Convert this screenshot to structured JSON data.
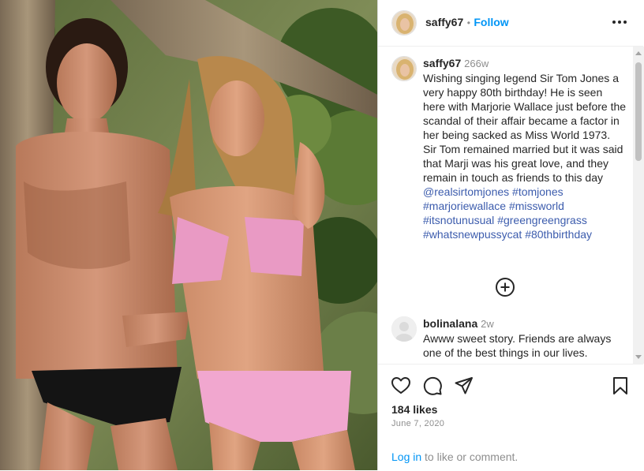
{
  "post": {
    "username": "saffy67",
    "separator": "•",
    "follow_label": "Follow",
    "more_icon": "more-horizontal-icon"
  },
  "caption": {
    "username": "saffy67",
    "time": "266w",
    "text": "Wishing singing legend Sir Tom Jones a very happy 80th birthday! He is seen here with Marjorie Wallace just before the scandal of their affair became a factor in her being sacked as Miss World 1973.  Sir Tom remained married but it was said that Marji was his great love, and they remain in touch as friends to this day ",
    "tags": [
      "@realsirtomjones",
      "#tomjones",
      "#marjoriewallace",
      "#missworld",
      "#itsnotunusual",
      "#greengreengrass",
      "#whatsnewpussycat",
      "#80thbirthday"
    ]
  },
  "comments": [
    {
      "username": "bolinalana",
      "time": "2w",
      "text": "Awww sweet story. Friends are always one of the best things in our lives."
    }
  ],
  "actions": {
    "likes": "184 likes",
    "date": "June 7, 2020",
    "login_link": "Log in",
    "login_rest": " to like or comment."
  },
  "colors": {
    "link_blue": "#0095f6",
    "hashtag": "#3c5cad",
    "muted": "#8e8e8e",
    "text": "#262626"
  }
}
